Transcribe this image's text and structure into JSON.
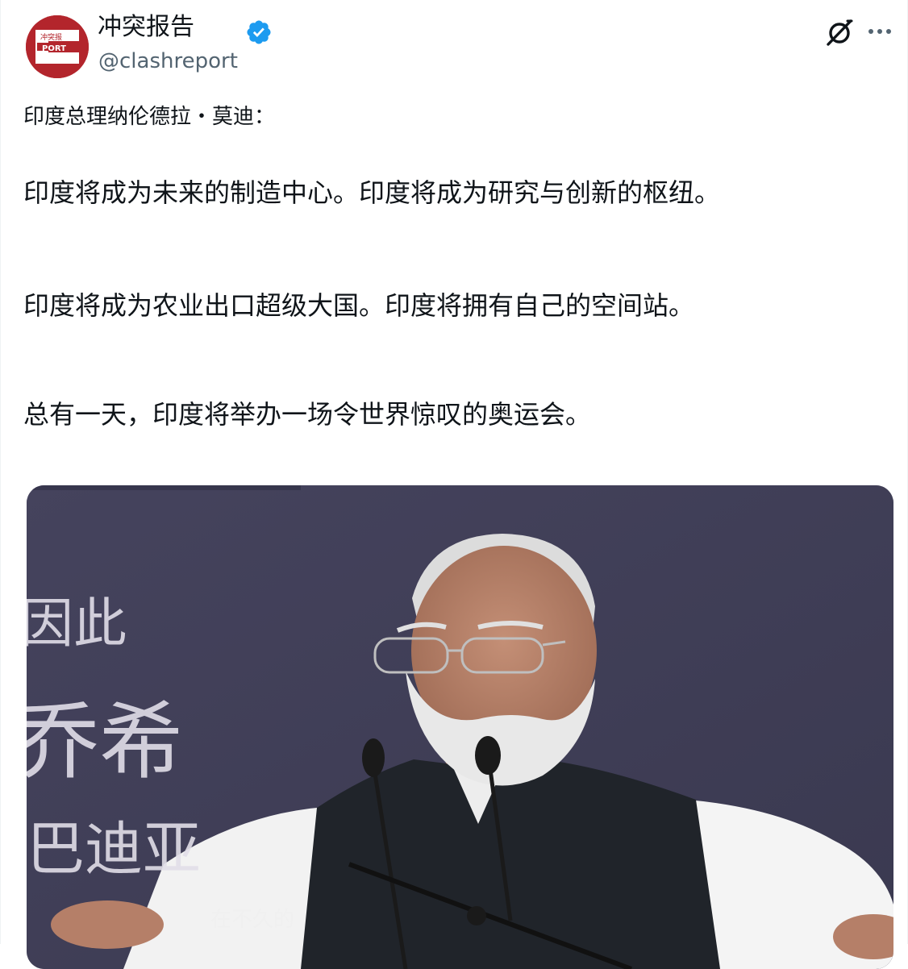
{
  "post": {
    "author": {
      "display_name": "冲突报告",
      "handle": "@clashreport",
      "avatar_text": "冲突报 PORT",
      "verified": true
    },
    "icons": {
      "verified": "verified-badge-icon",
      "grok": "grok-icon",
      "more": "more-icon"
    },
    "text": {
      "intro": "印度总理纳伦德拉・莫迪：",
      "line1": "印度将成为未来的制造中心。印度将成为研究与创新的枢纽。",
      "line2": "印度将成为农业出口超级大国。印度将拥有自己的空间站。",
      "line3": "总有一天，印度将举办一场令世界惊叹的奥运会。"
    },
    "media": {
      "overlay_1": "因此",
      "overlay_2": "乔希",
      "overlay_3": "巴迪亚",
      "caption": "在不久的"
    }
  },
  "colors": {
    "verified": "#1d9bf0",
    "secondary_text": "#536471",
    "avatar_red": "#b3252c",
    "media_bg": "#3f3e55"
  }
}
